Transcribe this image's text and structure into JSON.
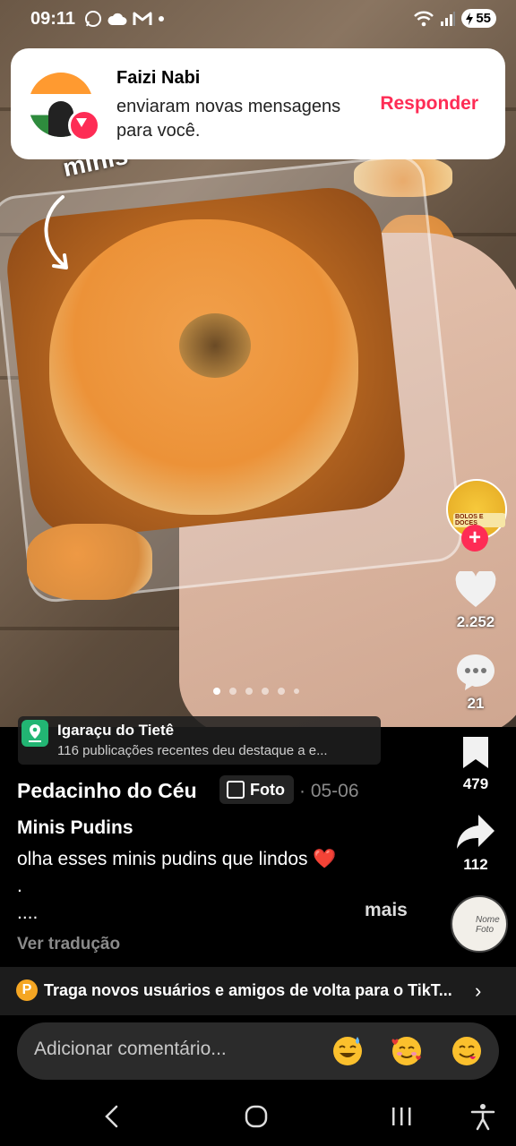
{
  "status_bar": {
    "time": "09:11",
    "battery": "55",
    "icons": [
      "whatsapp-icon",
      "cloud-icon",
      "gmail-icon",
      "dot-icon",
      "wifi-icon",
      "signal-icon",
      "battery-icon"
    ]
  },
  "notification": {
    "sender": "Faizi Nabi",
    "message": "enviaram novas mensagens para você.",
    "action": "Responder"
  },
  "photo": {
    "overlay_text": "minis",
    "dots_total": 6,
    "dots_active": 1
  },
  "right_rail": {
    "profile_avatar_label": "BOLOS E DOCES",
    "follow_symbol": "+",
    "likes": "2.252",
    "comments": "21",
    "bookmarks": "479",
    "shares": "112"
  },
  "location": {
    "title": "Igaraçu do Tietê",
    "subtitle": "116 publicações recentes deu destaque a e..."
  },
  "post": {
    "author": "Pedacinho do Céu",
    "type_badge": "Foto",
    "date": "· 05-06",
    "title": "Minis Pudins",
    "line1": "olha esses minis pudins que lindos ❤️",
    "line2": ".",
    "line3": "....",
    "more": "mais",
    "translate": "Ver tradução"
  },
  "promo": {
    "coin": "P",
    "text": "Traga novos usuários e amigos de volta para o TikT...",
    "chevron": "›"
  },
  "comment": {
    "placeholder": "Adicionar comentário...",
    "emojis": [
      "smiling-sweat-emoji",
      "smiling-hearts-emoji",
      "yum-emoji"
    ]
  },
  "nav": {
    "items": [
      "back-icon",
      "home-icon",
      "recents-icon",
      "accessibility-icon"
    ]
  },
  "colors": {
    "accent": "#fe2c55",
    "background": "#000000",
    "muted": "#8a8a8a"
  }
}
